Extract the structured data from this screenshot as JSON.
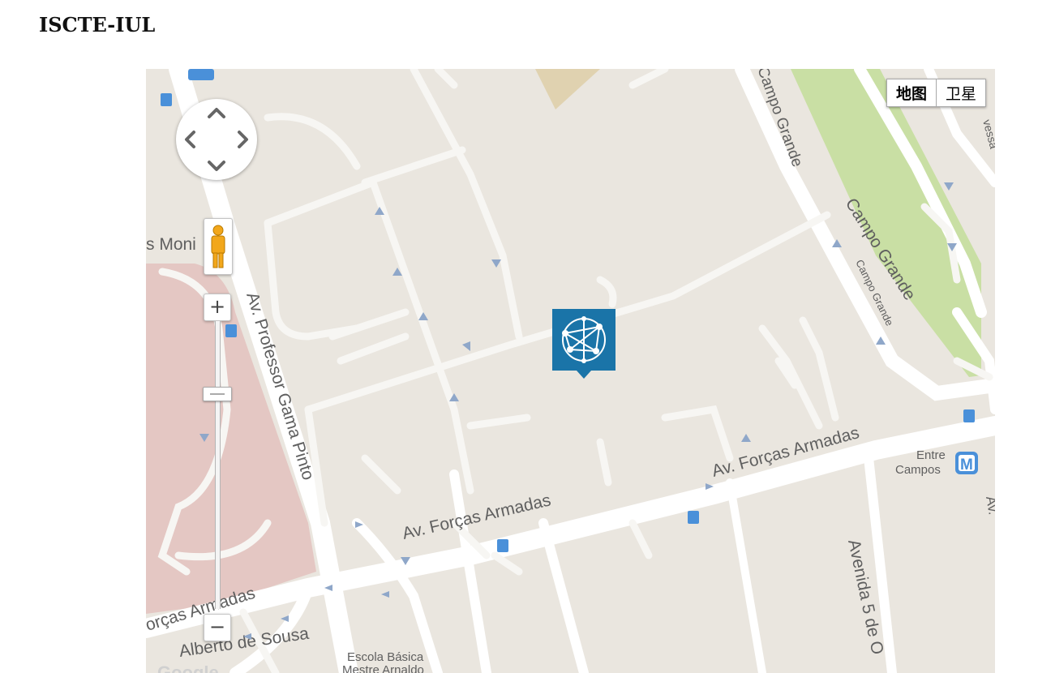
{
  "page": {
    "title": "ISCTE-IUL"
  },
  "map": {
    "type_buttons": {
      "map": "地图",
      "satellite": "卫星",
      "active": "map"
    },
    "zoom": {
      "in_label": "+",
      "out_label": "−"
    },
    "marker": {
      "name": "ISCTE-IUL",
      "icon": "network-globe-icon",
      "color": "#1a74a8"
    },
    "labels": {
      "av_professor": "Av. Professor Gama Pinto",
      "forcas_1": "Av. Forças Armadas",
      "forcas_2": "Av. Forças Armadas",
      "forcas_3": "orças Armadas",
      "campo_grande_1": "Campo Grande",
      "campo_grande_2": "Campo Grande",
      "campo_grande_3": "Campo Grande",
      "entre_1": "Entre",
      "entre_2": "Campos",
      "metro": "M",
      "monis": "s Moni",
      "alberto": "Alberto de Sousa",
      "escola_1": "Escola Básica",
      "escola_2": "Mestre Arnaldo",
      "avenida5": "Avenida 5 de O",
      "av_right": "Av.",
      "travessa": "vessa",
      "google": "Google"
    },
    "colors": {
      "land": "#eae6df",
      "road": "#ffffff",
      "park": "#c9dfa4",
      "hospital": "#e4c7c3",
      "sand": "#e0d2b0"
    }
  }
}
